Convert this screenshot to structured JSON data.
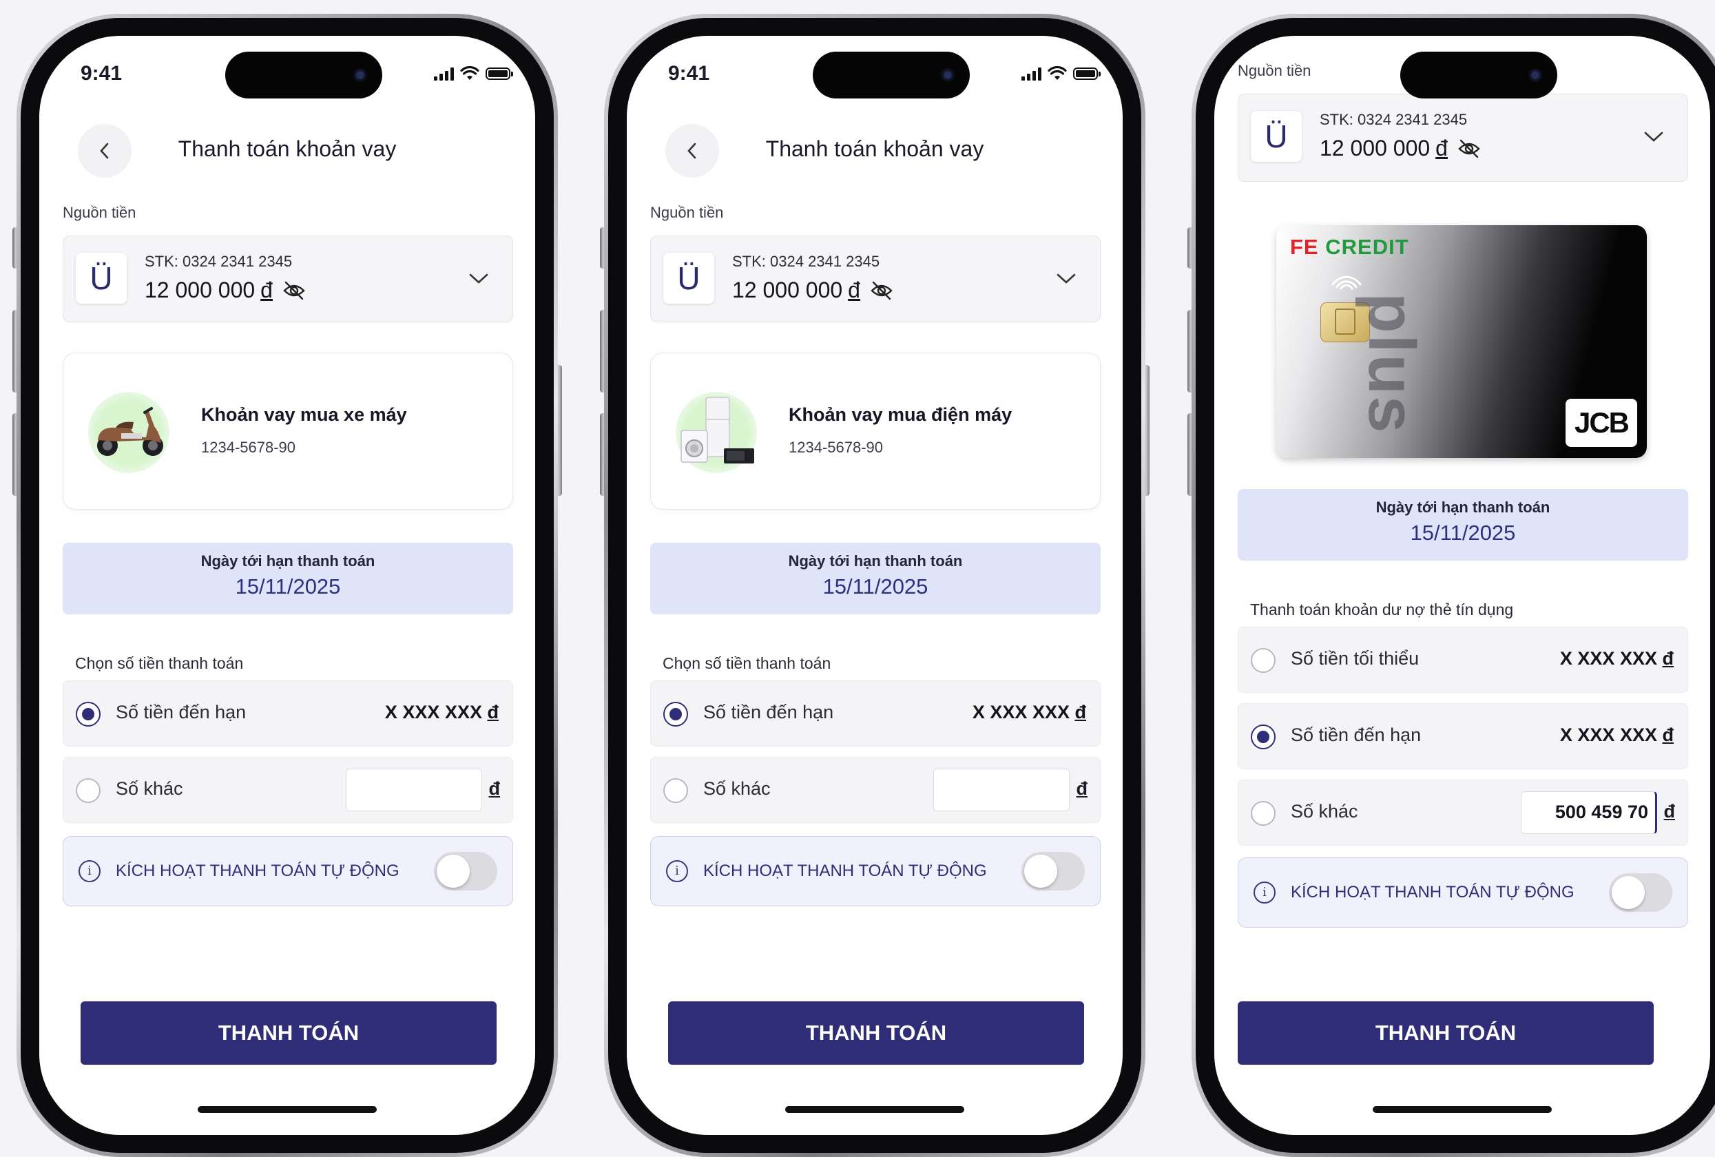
{
  "colors": {
    "primary": "#2f2c78",
    "due_box_bg": "#e0e4f8",
    "auto_box_bg": "#f1f1fb",
    "fe_red": "#e0222b",
    "fe_green": "#1f9a3d"
  },
  "screens": [
    {
      "status": {
        "time": "9:41"
      },
      "title": "Thanh toán khoản vay",
      "source": {
        "label": "Nguồn tiền",
        "logo": "Ü",
        "account": "STK: 0324 2341 2345",
        "balance": "12 000 000",
        "currency": "đ"
      },
      "loan": {
        "title": "Khoản vay mua xe máy",
        "number": "1234-5678-90",
        "icon": "scooter-icon"
      },
      "due": {
        "label": "Ngày tới hạn thanh toán",
        "date": "15/11/2025"
      },
      "amount_section": {
        "title": "Chọn số tiền thanh toán"
      },
      "options": [
        {
          "label": "Số tiền đến hạn",
          "amount": "X XXX XXX",
          "currency": "đ",
          "selected": true
        },
        {
          "label": "Số khác",
          "value": "",
          "currency": "đ",
          "selected": false
        }
      ],
      "auto_pay": {
        "label": "KÍCH HOẠT THANH TOÁN TỰ ĐỘNG",
        "info": "i",
        "enabled": false
      },
      "pay_button": "THANH TOÁN"
    },
    {
      "status": {
        "time": "9:41"
      },
      "title": "Thanh toán khoản vay",
      "source": {
        "label": "Nguồn tiền",
        "logo": "Ü",
        "account": "STK: 0324 2341 2345",
        "balance": "12 000 000",
        "currency": "đ"
      },
      "loan": {
        "title": "Khoản vay mua điện máy",
        "number": "1234-5678-90",
        "icon": "appliances-icon"
      },
      "due": {
        "label": "Ngày tới hạn thanh toán",
        "date": "15/11/2025"
      },
      "amount_section": {
        "title": "Chọn số tiền thanh toán"
      },
      "options": [
        {
          "label": "Số tiền đến hạn",
          "amount": "X XXX XXX",
          "currency": "đ",
          "selected": true
        },
        {
          "label": "Số khác",
          "value": "",
          "currency": "đ",
          "selected": false
        }
      ],
      "auto_pay": {
        "label": "KÍCH HOẠT THANH TOÁN TỰ ĐỘNG",
        "info": "i",
        "enabled": false
      },
      "pay_button": "THANH TOÁN"
    },
    {
      "source": {
        "label": "Nguồn tiền",
        "logo": "Ü",
        "account": "STK: 0324 2341 2345",
        "balance": "12 000 000",
        "currency": "đ"
      },
      "card": {
        "brand_fe": "FE",
        "brand_credit": "CREDIT",
        "product": "plus",
        "network": "JCB"
      },
      "due": {
        "label": "Ngày tới hạn thanh toán",
        "date": "15/11/2025"
      },
      "amount_section": {
        "title": "Thanh toán khoản dư nợ thẻ tín dụng"
      },
      "options": [
        {
          "label": "Số tiền tối thiểu",
          "amount": "X XXX XXX",
          "currency": "đ",
          "selected": false
        },
        {
          "label": "Số tiền đến hạn",
          "amount": "X XXX XXX",
          "currency": "đ",
          "selected": true
        },
        {
          "label": "Số khác",
          "value": "500 459 70",
          "currency": "đ",
          "selected": false
        }
      ],
      "auto_pay": {
        "label": "KÍCH HOẠT THANH TOÁN TỰ ĐỘNG",
        "info": "i",
        "enabled": false
      },
      "pay_button": "THANH TOÁN"
    }
  ]
}
